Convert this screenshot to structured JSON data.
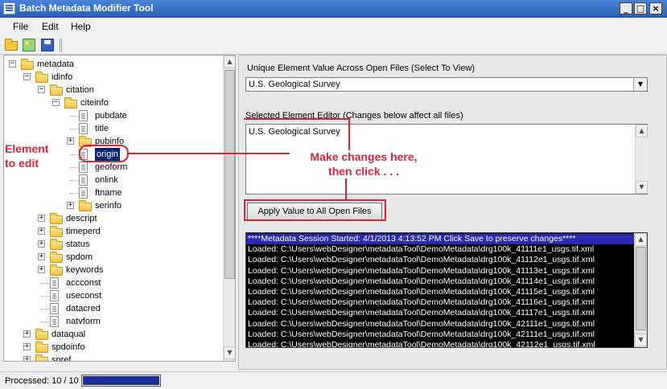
{
  "window": {
    "title": "Batch Metadata Modifier Tool",
    "minimize": "_",
    "maximize": "□",
    "close": "×"
  },
  "menu": [
    "File",
    "Edit",
    "Help"
  ],
  "toolbar": [
    "open-folder-icon",
    "open-image-icon",
    "save-icon"
  ],
  "tree": {
    "nodes": [
      {
        "label": "metadata",
        "icon": "folder",
        "expander": "⊟",
        "level": 0
      },
      {
        "label": "idinfo",
        "icon": "folder",
        "expander": "⊟",
        "level": 1
      },
      {
        "label": "citation",
        "icon": "folder",
        "expander": "⊟",
        "level": 2
      },
      {
        "label": "citeinfo",
        "icon": "folder",
        "expander": "⊟",
        "level": 3
      },
      {
        "label": "pubdate",
        "icon": "doc",
        "expander": "",
        "level": 4
      },
      {
        "label": "title",
        "icon": "doc",
        "expander": "",
        "level": 4
      },
      {
        "label": "pubinfo",
        "icon": "folder",
        "expander": "⊞",
        "level": 4
      },
      {
        "label": "origin",
        "icon": "doc",
        "expander": "",
        "level": 4,
        "selected": true
      },
      {
        "label": "geoform",
        "icon": "doc",
        "expander": "",
        "level": 4
      },
      {
        "label": "onlink",
        "icon": "doc",
        "expander": "",
        "level": 4
      },
      {
        "label": "ftname",
        "icon": "doc",
        "expander": "",
        "level": 4
      },
      {
        "label": "serinfo",
        "icon": "folder",
        "expander": "⊞",
        "level": 4
      },
      {
        "label": "descript",
        "icon": "folder",
        "expander": "⊞",
        "level": 2
      },
      {
        "label": "timeperd",
        "icon": "folder",
        "expander": "⊞",
        "level": 2
      },
      {
        "label": "status",
        "icon": "folder",
        "expander": "⊞",
        "level": 2
      },
      {
        "label": "spdom",
        "icon": "folder",
        "expander": "⊞",
        "level": 2
      },
      {
        "label": "keywords",
        "icon": "folder",
        "expander": "⊞",
        "level": 2
      },
      {
        "label": "accconst",
        "icon": "doc",
        "expander": "",
        "level": 2
      },
      {
        "label": "useconst",
        "icon": "doc",
        "expander": "",
        "level": 2
      },
      {
        "label": "datacred",
        "icon": "doc",
        "expander": "",
        "level": 2
      },
      {
        "label": "natvform",
        "icon": "doc",
        "expander": "",
        "level": 2
      },
      {
        "label": "dataqual",
        "icon": "folder",
        "expander": "⊞",
        "level": 1
      },
      {
        "label": "spdoinfo",
        "icon": "folder",
        "expander": "⊞",
        "level": 1
      },
      {
        "label": "spref",
        "icon": "folder",
        "expander": "⊞",
        "level": 1
      }
    ]
  },
  "main": {
    "unique_label": "Unique Element Value Across Open Files (Select To View)",
    "unique_value": "U.S. Geological Survey",
    "editor_label": "Selected Element Editor (Changes below affect all files)",
    "editor_value": "U.S. Geological Survey",
    "apply_label": "Apply Value to All Open Files",
    "log": [
      "****Metadata Session Started: 4/1/2013 4:13:52 PM Click Save to preserve changes****",
      "Loaded: C:\\Users\\webDesigner\\metadataTool\\DemoMetadata\\drg100k_41111e1_usgs.tif.xml",
      "Loaded: C:\\Users\\webDesigner\\metadataTool\\DemoMetadata\\drg100k_41112e1_usgs.tif.xml",
      "Loaded: C:\\Users\\webDesigner\\metadataTool\\DemoMetadata\\drg100k_41113e1_usgs.tif.xml",
      "Loaded: C:\\Users\\webDesigner\\metadataTool\\DemoMetadata\\drg100k_41114e1_usgs.tif.xml",
      "Loaded: C:\\Users\\webDesigner\\metadataTool\\DemoMetadata\\drg100k_41115e1_usgs.tif.xml",
      "Loaded: C:\\Users\\webDesigner\\metadataTool\\DemoMetadata\\drg100k_41116e1_usgs.tif.xml",
      "Loaded: C:\\Users\\webDesigner\\metadataTool\\DemoMetadata\\drg100k_41117e1_usgs.tif.xml",
      "Loaded: C:\\Users\\webDesigner\\metadataTool\\DemoMetadata\\drg100k_42111e1_usgs.tif.xml",
      "Loaded: C:\\Users\\webDesigner\\metadataTool\\DemoMetadata\\drg100k_42111e1_usgs.tif.xml",
      "Loaded: C:\\Users\\webDesigner\\metadataTool\\DemoMetadata\\drg100k_42112e1_usgs.tif.xml"
    ]
  },
  "status": {
    "text": "Processed: 10 / 10",
    "progress": 1.0
  },
  "annotations": {
    "element_to_edit": "Element\nto edit",
    "make_changes": "Make changes here,\nthen click . . .",
    "color": "#d8253a"
  },
  "colors": {
    "title_bar": "#2a60b8",
    "selection": "#0a246a",
    "log_header": "#2a2ab0",
    "progress": "#1d2d9a"
  }
}
